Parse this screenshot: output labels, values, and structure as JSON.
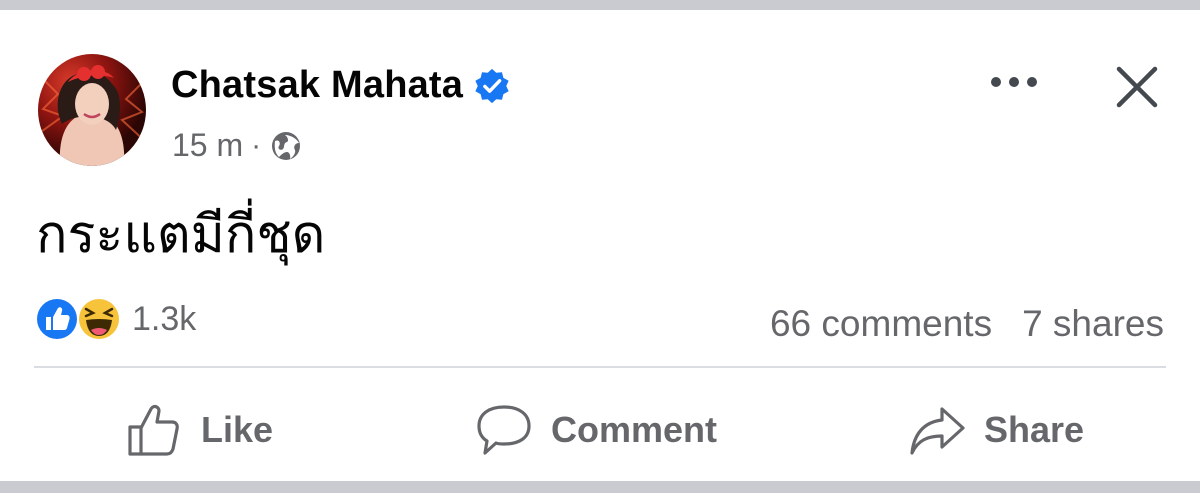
{
  "post": {
    "author": "Chatsak Mahata",
    "verified": true,
    "timestamp": "15 m",
    "separator": "·",
    "audience_icon": "globe-icon",
    "text": "กระแตมีกี่ชุด"
  },
  "reactions": {
    "icons": [
      "like-reaction-icon",
      "haha-reaction-icon"
    ],
    "count": "1.3k"
  },
  "stats": {
    "comments": "66 comments",
    "shares": "7 shares"
  },
  "actions": {
    "like": "Like",
    "comment": "Comment",
    "share": "Share"
  },
  "colors": {
    "verified": "#1877f2",
    "secondary_text": "#65676b",
    "like_blue": "#1877f2",
    "haha_yellow": "#f7c33a"
  }
}
